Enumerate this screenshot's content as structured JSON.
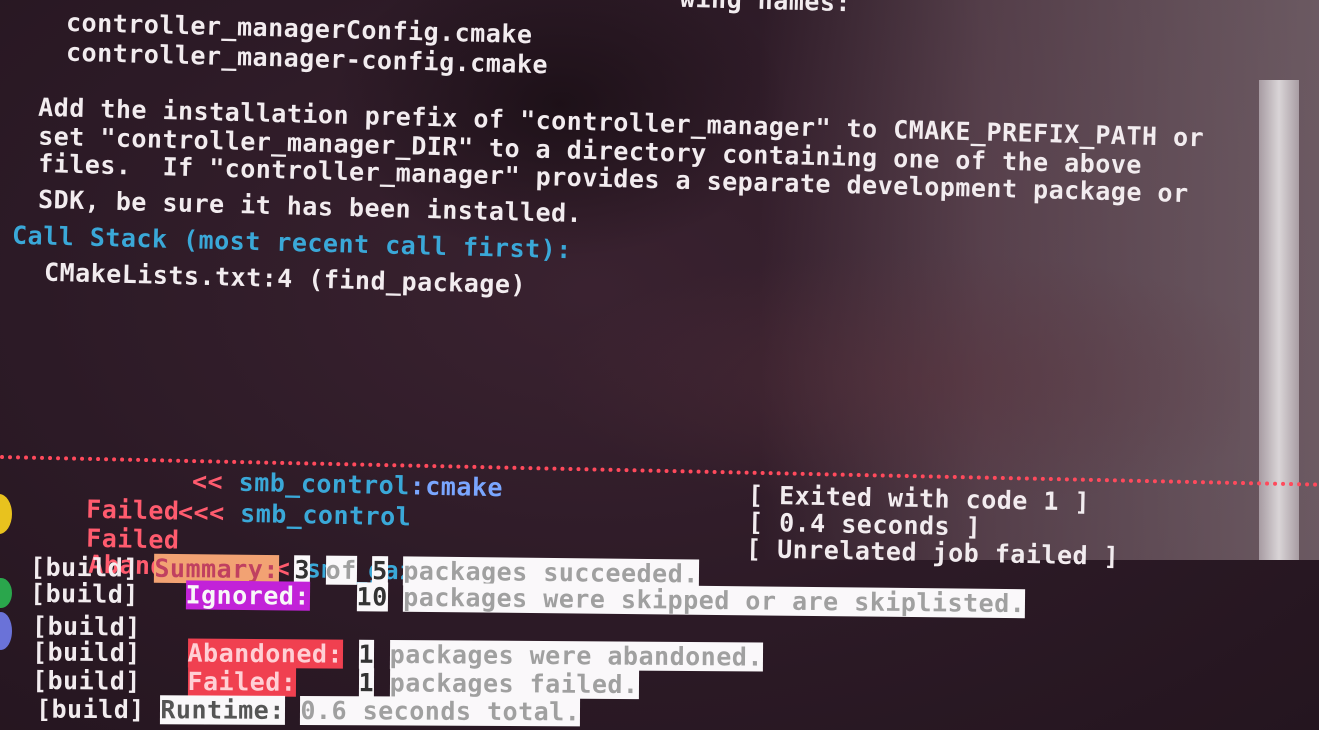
{
  "terminal": {
    "partial_header": "wing names:",
    "config_file_1": "controller_managerConfig.cmake",
    "config_file_2": "controller_manager-config.cmake",
    "advice_1": "Add the installation prefix of \"controller_manager\" to CMAKE_PREFIX_PATH or",
    "advice_2": "set \"controller_manager_DIR\" to a directory containing one of the above",
    "advice_3": "files.  If \"controller_manager\" provides a separate development package or",
    "advice_4": "SDK, be sure it has been installed.",
    "call_stack_label": "Call Stack (most recent call first):",
    "call_stack_entry": "CMakeLists.txt:4 (find_package)",
    "jobs": [
      {
        "status": "Failed",
        "arrows": "<<",
        "package": "smb_control",
        "stage": ":cmake",
        "info": "[ Exited with code 1 ]"
      },
      {
        "status": "Failed",
        "arrows": "<<<",
        "package": "smb_control",
        "stage": "",
        "info": "[ 0.4 seconds ]"
      },
      {
        "status": "Abandoned",
        "arrows": "<<<",
        "package": "smb_gazebo",
        "stage": "",
        "info": "[ Unrelated job failed ]"
      }
    ],
    "build_tag": "[build]",
    "summary": {
      "label": "Summary:",
      "succeeded_count": "3",
      "of": "of",
      "total": "5",
      "succeeded_text": "packages succeeded."
    },
    "ignored": {
      "label": "Ignored:",
      "count": "10",
      "text": "packages were skipped or are skiplisted."
    },
    "abandoned": {
      "label": "Abandoned:",
      "count": "1",
      "text": "packages were abandoned."
    },
    "failed": {
      "label": "Failed:",
      "count": "1",
      "text": "packages failed."
    },
    "runtime": {
      "label": "Runtime:",
      "value": "0.6 seconds total."
    },
    "colors": {
      "failed_red": "#ff5b6e",
      "cyan": "#3aa8d8",
      "summary_bg": "#f2a273",
      "ignored_bg": "#c222d8",
      "abandoned_bg": "#f04050"
    }
  }
}
